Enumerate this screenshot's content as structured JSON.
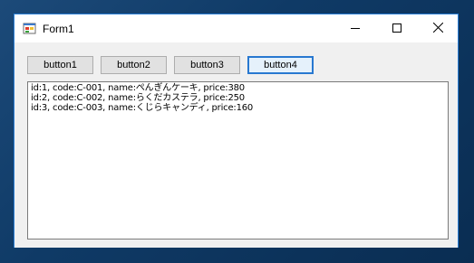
{
  "window": {
    "title": "Form1",
    "icon": "winforms-app-icon",
    "controls": {
      "minimize_icon": "minimize-icon",
      "maximize_icon": "maximize-icon",
      "close_icon": "close-icon"
    }
  },
  "buttons": [
    {
      "label": "button1"
    },
    {
      "label": "button2"
    },
    {
      "label": "button3"
    },
    {
      "label": "button4",
      "focused": true
    }
  ],
  "textbox": {
    "lines": [
      "id:1, code:C-001, name:ぺんぎんケーキ, price:380",
      "id:2, code:C-002, name:らくだカステラ, price:250",
      "id:3, code:C-003, name:くじらキャンディ, price:160"
    ]
  },
  "colors": {
    "accent_border": "#2b7fd6",
    "focus_border": "#2878d0",
    "desktop": "#0f3a66"
  }
}
